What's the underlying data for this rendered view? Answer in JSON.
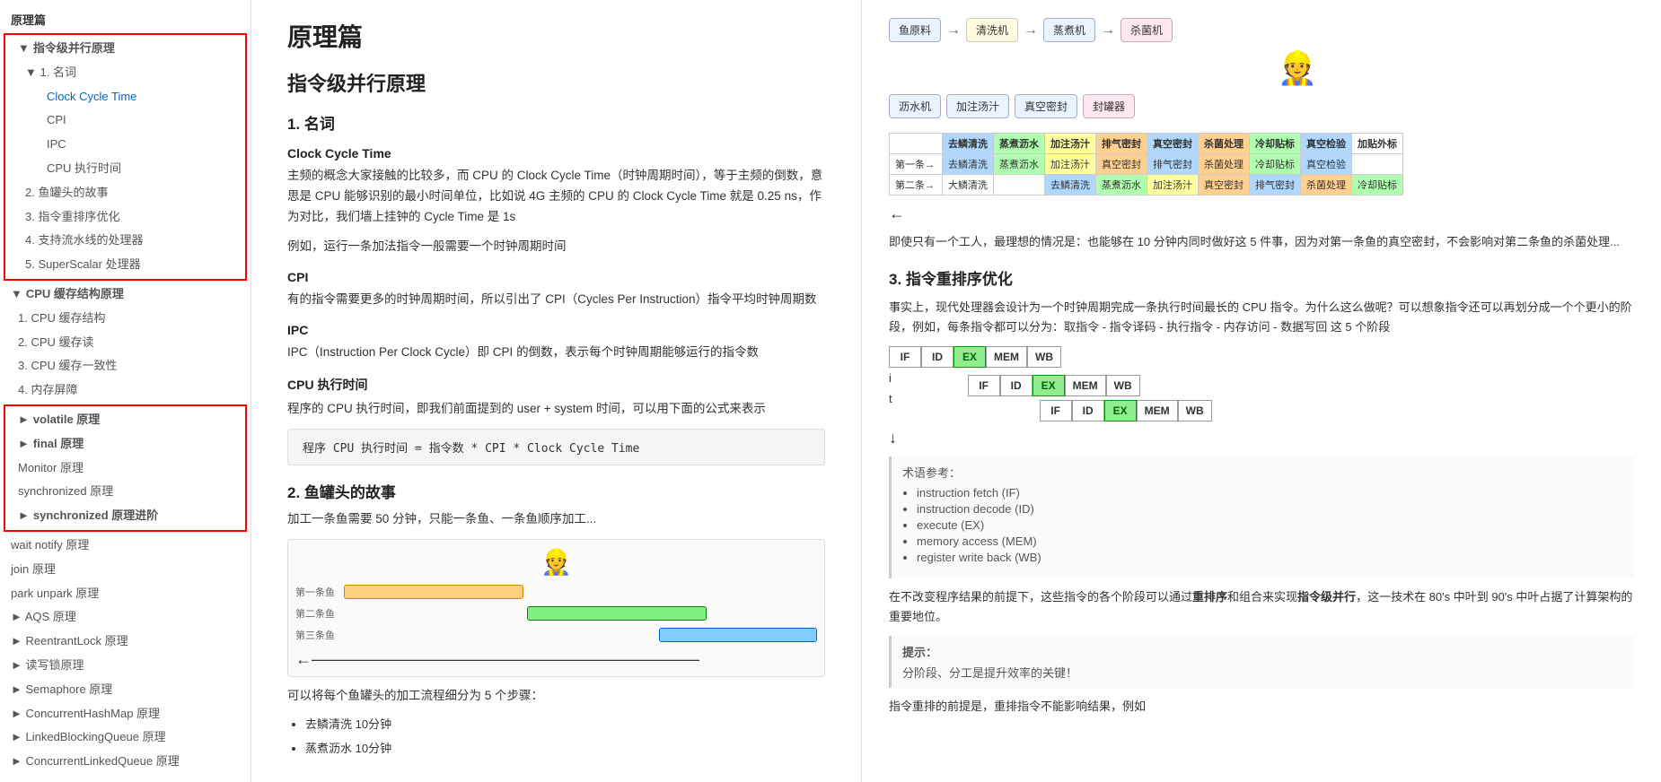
{
  "sidebar": {
    "top_section": "原理篇",
    "groups": [
      {
        "id": "instruction-parallel",
        "label": "指令级并行原理",
        "expanded": true,
        "red_box": true,
        "children": [
          {
            "id": "terms",
            "label": "1. 名词",
            "expanded": true,
            "children": [
              {
                "id": "clock-cycle",
                "label": "Clock Cycle Time"
              },
              {
                "id": "cpi",
                "label": "CPI"
              },
              {
                "id": "ipc",
                "label": "IPC"
              },
              {
                "id": "cpu-time",
                "label": "CPU 执行时间"
              }
            ]
          },
          {
            "id": "fish-story",
            "label": "2. 鱼罐头的故事"
          },
          {
            "id": "reorder",
            "label": "3. 指令重排序优化"
          },
          {
            "id": "pipeline-processor",
            "label": "4. 支持流水线的处理器"
          },
          {
            "id": "superscalar",
            "label": "5. SuperScalar 处理器"
          }
        ]
      },
      {
        "id": "cpu-cache",
        "label": "CPU 缓存结构原理",
        "expanded": true,
        "children": [
          {
            "id": "cache-struct",
            "label": "1. CPU 缓存结构"
          },
          {
            "id": "cache-read",
            "label": "2. CPU 缓存读"
          },
          {
            "id": "cache-consistency",
            "label": "3. CPU 缓存一致性"
          },
          {
            "id": "memory-barrier",
            "label": "4. 内存屏障"
          }
        ]
      },
      {
        "id": "volatile",
        "label": "volatile 原理",
        "expanded": false,
        "red_box": true
      },
      {
        "id": "final",
        "label": "final 原理",
        "expanded": false,
        "red_box": true
      },
      {
        "id": "monitor",
        "label": "Monitor 原理",
        "red_box": true
      },
      {
        "id": "synchronized",
        "label": "synchronized 原理",
        "red_box": true
      },
      {
        "id": "synchronized-advanced",
        "label": "synchronized 原理进阶",
        "expanded": false,
        "red_box": true
      },
      {
        "id": "wait-notify",
        "label": "wait notify 原理"
      },
      {
        "id": "join",
        "label": "join 原理"
      },
      {
        "id": "park-unpark",
        "label": "park unpark 原理"
      },
      {
        "id": "aqs",
        "label": "AQS 原理",
        "has_arrow": true
      },
      {
        "id": "reentrant-lock",
        "label": "ReentrantLock 原理",
        "has_arrow": true
      },
      {
        "id": "read-write-lock",
        "label": "读写锁原理",
        "has_arrow": true
      },
      {
        "id": "semaphore",
        "label": "Semaphore 原理",
        "has_arrow": true
      },
      {
        "id": "concurrent-hashmap",
        "label": "ConcurrentHashMap 原理",
        "has_arrow": true
      },
      {
        "id": "linked-blocking-queue",
        "label": "LinkedBlockingQueue 原理",
        "has_arrow": true
      },
      {
        "id": "concurrent-linked-queue",
        "label": "ConcurrentLinkedQueue 原理",
        "has_arrow": true
      }
    ]
  },
  "main": {
    "page_title": "原理篇",
    "section1_title": "指令级并行原理",
    "sub1_title": "1. 名词",
    "term1": "Clock Cycle Time",
    "term1_desc": "主频的概念大家接触的比较多，而 CPU 的 Clock Cycle Time（时钟周期时间），等于主频的倒数，意思是 CPU 能够识别的最小时间单位，比如说 4G 主频的 CPU 的 Clock Cycle Time 就是 0.25 ns，作为对比，我们墙上挂钟的 Cycle Time 是 1s",
    "term1_example": "例如，运行一条加法指令一般需要一个时钟周期时间",
    "term2": "CPI",
    "term2_desc": "有的指令需要更多的时钟周期时间，所以引出了 CPI（Cycles Per Instruction）指令平均时钟周期数",
    "term3": "IPC",
    "term3_desc": "IPC（Instruction Per Clock Cycle）即 CPI 的倒数，表示每个时钟周期能够运行的指令数",
    "term4": "CPU 执行时间",
    "term4_desc": "程序的 CPU 执行时间，即我们前面提到的 user + system 时间，可以用下面的公式来表示",
    "formula": "程序 CPU 执行时间 = 指令数 * CPI * Clock Cycle Time",
    "sub2_title": "2. 鱼罐头的故事",
    "fish_desc": "加工一条鱼需要 50 分钟，只能一条鱼、一条鱼顺序加工...",
    "fish_steps_title": "可以将每个鱼罐头的加工流程细分为 5 个步骤：",
    "fish_steps": [
      "去鳞清洗 10分钟",
      "蒸煮沥水 10分钟"
    ]
  },
  "right": {
    "section1_desc": "即使只有一个工人，最理想的情况是：也能够在 10 分钟内同时做好这 5 件事，因为对第一条鱼的真空密封，不会影响对第二条鱼的杀菌处理...",
    "section3_title": "3. 指令重排序优化",
    "section3_desc": "事实上，现代处理器会设计为一个时钟周期完成一条执行时间最长的 CPU 指令。为什么这么做呢？可以想象指令还可以再划分成一个个更小的阶段，例如，每条指令都可以分为：取指令 - 指令译码 - 执行指令 - 内存访问 - 数据写回 这 5 个阶段",
    "stages": [
      "IF",
      "ID",
      "EX",
      "MEM",
      "WB"
    ],
    "pipeline_rows": [
      {
        "indent": 0,
        "label": "i",
        "stages": [
          "IF",
          "ID",
          "EX",
          "MEM",
          "WB"
        ]
      },
      {
        "indent": 1,
        "label": "",
        "stages": [
          "IF",
          "ID",
          "EX",
          "MEM",
          "WB"
        ]
      },
      {
        "indent": 2,
        "label": "t",
        "stages": [
          "IF",
          "ID",
          "EX",
          "MEM",
          "WB"
        ]
      }
    ],
    "terms_ref_title": "术语参考：",
    "terms_ref": [
      "instruction fetch (IF)",
      "instruction decode (ID)",
      "execute (EX)",
      "memory access (MEM)",
      "register write back (WB)"
    ],
    "reorder_desc": "在不改变程序结果的前提下，这些指令的各个阶段可以通过重排序和组合来实现指令级并行，这一技术在 80's 中叶到 90's 中叶占据了计算架构的重要地位。",
    "hint_title": "提示：",
    "hint_desc": "分阶段、分工是提升效率的关键！",
    "reorder_premise": "指令重排的前提是，重排指令不能影响结果，例如"
  },
  "icons": {
    "expand": "▼",
    "collapse": "►",
    "arrow_right": "→",
    "arrow_down": "↓",
    "bullet": "•"
  }
}
